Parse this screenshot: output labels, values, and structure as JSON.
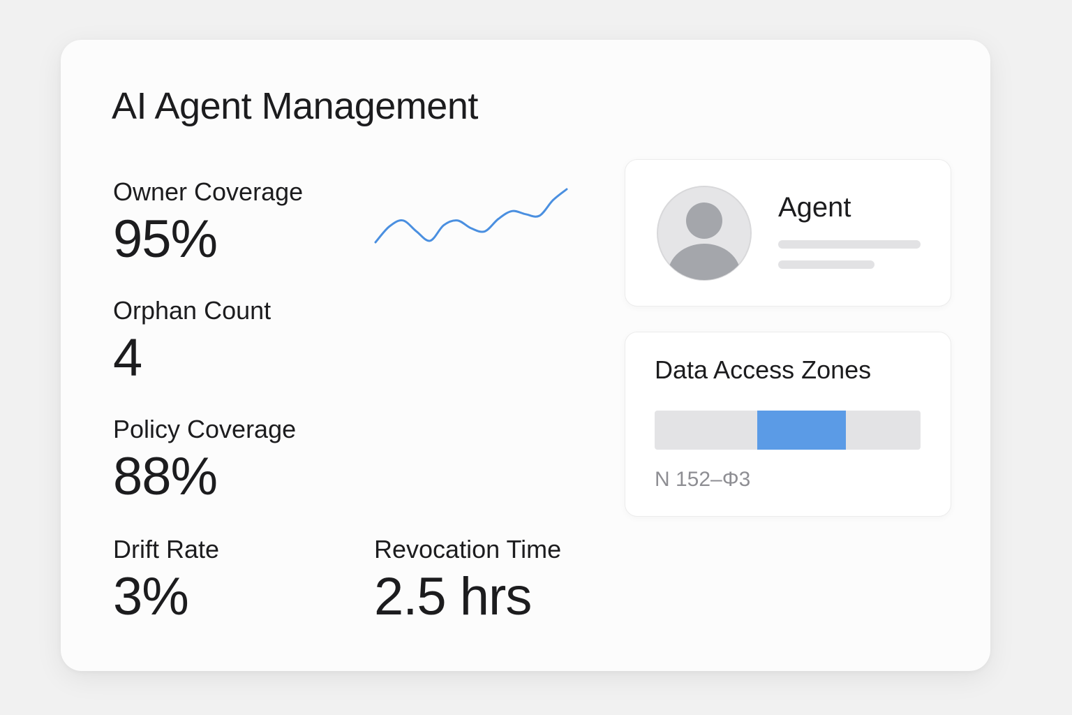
{
  "header": {
    "title": "AI Agent Management"
  },
  "metrics": {
    "owner_coverage": {
      "label": "Owner Coverage",
      "value": "95%"
    },
    "orphan_count": {
      "label": "Orphan Count",
      "value": "4"
    },
    "policy_coverage": {
      "label": "Policy Coverage",
      "value": "88%"
    },
    "drift_rate": {
      "label": "Drift Rate",
      "value": "3%"
    },
    "revocation_time": {
      "label": "Revocation Time",
      "value": "2.5 hrs"
    }
  },
  "trend": {
    "color": "#4a8fe0",
    "values": [
      0.0,
      0.5,
      0.7,
      0.35,
      0.05,
      0.55,
      0.7,
      0.45,
      0.35,
      0.75,
      1.0,
      0.9,
      0.85,
      1.35,
      1.7
    ]
  },
  "agent_card": {
    "name": "Agent",
    "avatar_icon": "user-avatar-icon"
  },
  "data_access_zones": {
    "title": "Data Access Zones",
    "segment_start_fraction": 0.385,
    "segment_end_fraction": 0.72,
    "caption": "N 152–Φ3",
    "track_color": "#e3e3e5",
    "fill_color": "#5b9be6"
  }
}
